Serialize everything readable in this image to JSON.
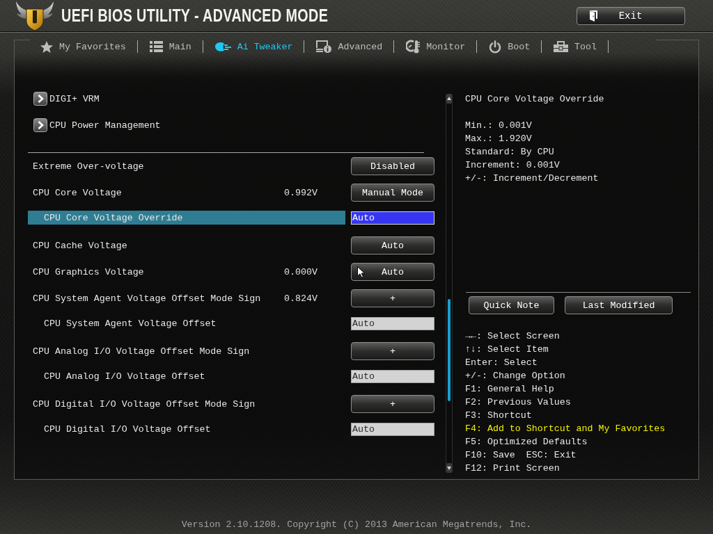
{
  "header": {
    "title": "UEFI BIOS UTILITY - ADVANCED MODE",
    "exit_button": "Exit"
  },
  "tabs": [
    {
      "label": "My Favorites",
      "selected": false
    },
    {
      "label": "Main",
      "selected": false
    },
    {
      "label": "Ai Tweaker",
      "selected": true
    },
    {
      "label": "Advanced",
      "selected": false
    },
    {
      "label": "Monitor",
      "selected": false
    },
    {
      "label": "Boot",
      "selected": false
    },
    {
      "label": "Tool",
      "selected": false
    }
  ],
  "submenus": [
    "DIGI+ VRM",
    "CPU Power Management"
  ],
  "settings": [
    {
      "label": "Extreme Over-voltage",
      "control": {
        "kind": "button",
        "value": "Disabled"
      },
      "selected": false
    },
    {
      "label": "CPU Core Voltage",
      "reading": "0.992V",
      "control": {
        "kind": "button",
        "value": "Manual Mode"
      },
      "selected": false,
      "children": [
        {
          "label": "CPU Core Voltage Override",
          "control": {
            "kind": "field",
            "value": "Auto"
          },
          "selected": true
        }
      ]
    },
    {
      "label": "CPU Cache Voltage",
      "control": {
        "kind": "button",
        "value": "Auto"
      },
      "selected": false
    },
    {
      "label": "CPU Graphics Voltage",
      "reading": "0.000V",
      "control": {
        "kind": "button",
        "value": "Auto"
      },
      "selected": false
    },
    {
      "label": "CPU System Agent Voltage Offset Mode Sign",
      "reading": "0.824V",
      "control": {
        "kind": "button",
        "value": "+"
      },
      "selected": false,
      "children": [
        {
          "label": "CPU System Agent Voltage Offset",
          "control": {
            "kind": "field",
            "value": "Auto"
          },
          "selected": false
        }
      ]
    },
    {
      "label": "CPU Analog I/O Voltage Offset Mode Sign",
      "control": {
        "kind": "button",
        "value": "+"
      },
      "selected": false,
      "children": [
        {
          "label": "CPU Analog I/O Voltage Offset",
          "control": {
            "kind": "field",
            "value": "Auto"
          },
          "selected": false
        }
      ]
    },
    {
      "label": "CPU Digital I/O Voltage Offset Mode Sign",
      "control": {
        "kind": "button",
        "value": "+"
      },
      "selected": false,
      "children": [
        {
          "label": "CPU Digital I/O Voltage Offset",
          "control": {
            "kind": "field",
            "value": "Auto"
          },
          "selected": false
        }
      ]
    }
  ],
  "help": {
    "title": "CPU Core Voltage Override",
    "lines": [
      "Min.: 0.001V",
      "Max.: 1.920V",
      "Standard: By CPU",
      "Increment: 0.001V",
      "+/-: Increment/Decrement"
    ]
  },
  "panel_buttons": [
    "Quick Note",
    "Last Modified"
  ],
  "key_help": [
    {
      "text": "→←: Select Screen",
      "highlighted": false
    },
    {
      "text": "↑↓: Select Item",
      "highlighted": false
    },
    {
      "text": "Enter: Select",
      "highlighted": false
    },
    {
      "text": "+/-: Change Option",
      "highlighted": false
    },
    {
      "text": "F1: General Help",
      "highlighted": false
    },
    {
      "text": "F2: Previous Values",
      "highlighted": false
    },
    {
      "text": "F3: Shortcut",
      "highlighted": false
    },
    {
      "text": "F4: Add to Shortcut and My Favorites",
      "highlighted": true
    },
    {
      "text": "F5: Optimized Defaults",
      "highlighted": false
    },
    {
      "text": "F10: Save  ESC: Exit",
      "highlighted": false
    },
    {
      "text": "F12: Print Screen",
      "highlighted": false
    }
  ],
  "footer": "Version 2.10.1208. Copyright (C) 2013 American Megatrends, Inc."
}
